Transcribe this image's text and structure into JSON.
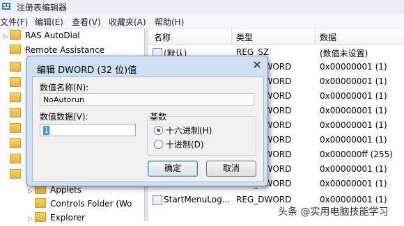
{
  "window": {
    "title": "注册表编辑器",
    "icon": "regedit-icon"
  },
  "menu": [
    "文件(F)",
    "编辑(E)",
    "查看(V)",
    "收藏夹(A)",
    "帮助(H)"
  ],
  "tree": [
    {
      "label": "RAS AutoDial",
      "arrow": "▷"
    },
    {
      "label": "Remote Assistance",
      "arrow": ""
    },
    {
      "label": "Applets",
      "arrow": "▷"
    },
    {
      "label": "Controls Folder (Wo",
      "arrow": ""
    },
    {
      "label": "Explorer",
      "arrow": "▷"
    }
  ],
  "list": {
    "columns": [
      "名称",
      "类型",
      "数据"
    ],
    "rows": [
      {
        "name": "(默认)",
        "type": "REG_SZ",
        "data": "(数值未设置)"
      },
      {
        "name": "",
        "type": "REG_DWORD",
        "data": "0x00000001 (1)"
      },
      {
        "name": "",
        "type": "REG_DWORD",
        "data": "0x00000001 (1)"
      },
      {
        "name": "",
        "type": "REG_DWORD",
        "data": "0x00000001 (1)"
      },
      {
        "name": "",
        "type": "REG_DWORD",
        "data": "0x00000001 (1)"
      },
      {
        "name": "",
        "type": "REG_DWORD",
        "data": "0x00000001 (1)"
      },
      {
        "name": "",
        "type": "REG_DWORD",
        "data": "0x00000001 (1)"
      },
      {
        "name": "",
        "type": "REG_DWORD",
        "data": "0x000000ff (255)"
      },
      {
        "name": "",
        "type": "REG_DWORD",
        "data": "0x00000001 (1)"
      },
      {
        "name": "",
        "type": "REG_DWORD",
        "data": "0x00000001 (1)"
      },
      {
        "name": "StartMenuLog...",
        "type": "REG_DWORD",
        "data": "0x00000001 (1)"
      }
    ]
  },
  "dialog": {
    "title": "编辑 DWORD (32 位)值",
    "name_label": "数值名称(N):",
    "name_value": "NoAutorun",
    "data_label": "数值数据(V):",
    "data_value": "1",
    "base_label": "基数",
    "hex_label": "十六进制(H)",
    "dec_label": "十进制(D)",
    "selected_base": "hex",
    "ok_label": "确定",
    "cancel_label": "取消"
  },
  "watermark": "头条 @实用电脑技能学习"
}
